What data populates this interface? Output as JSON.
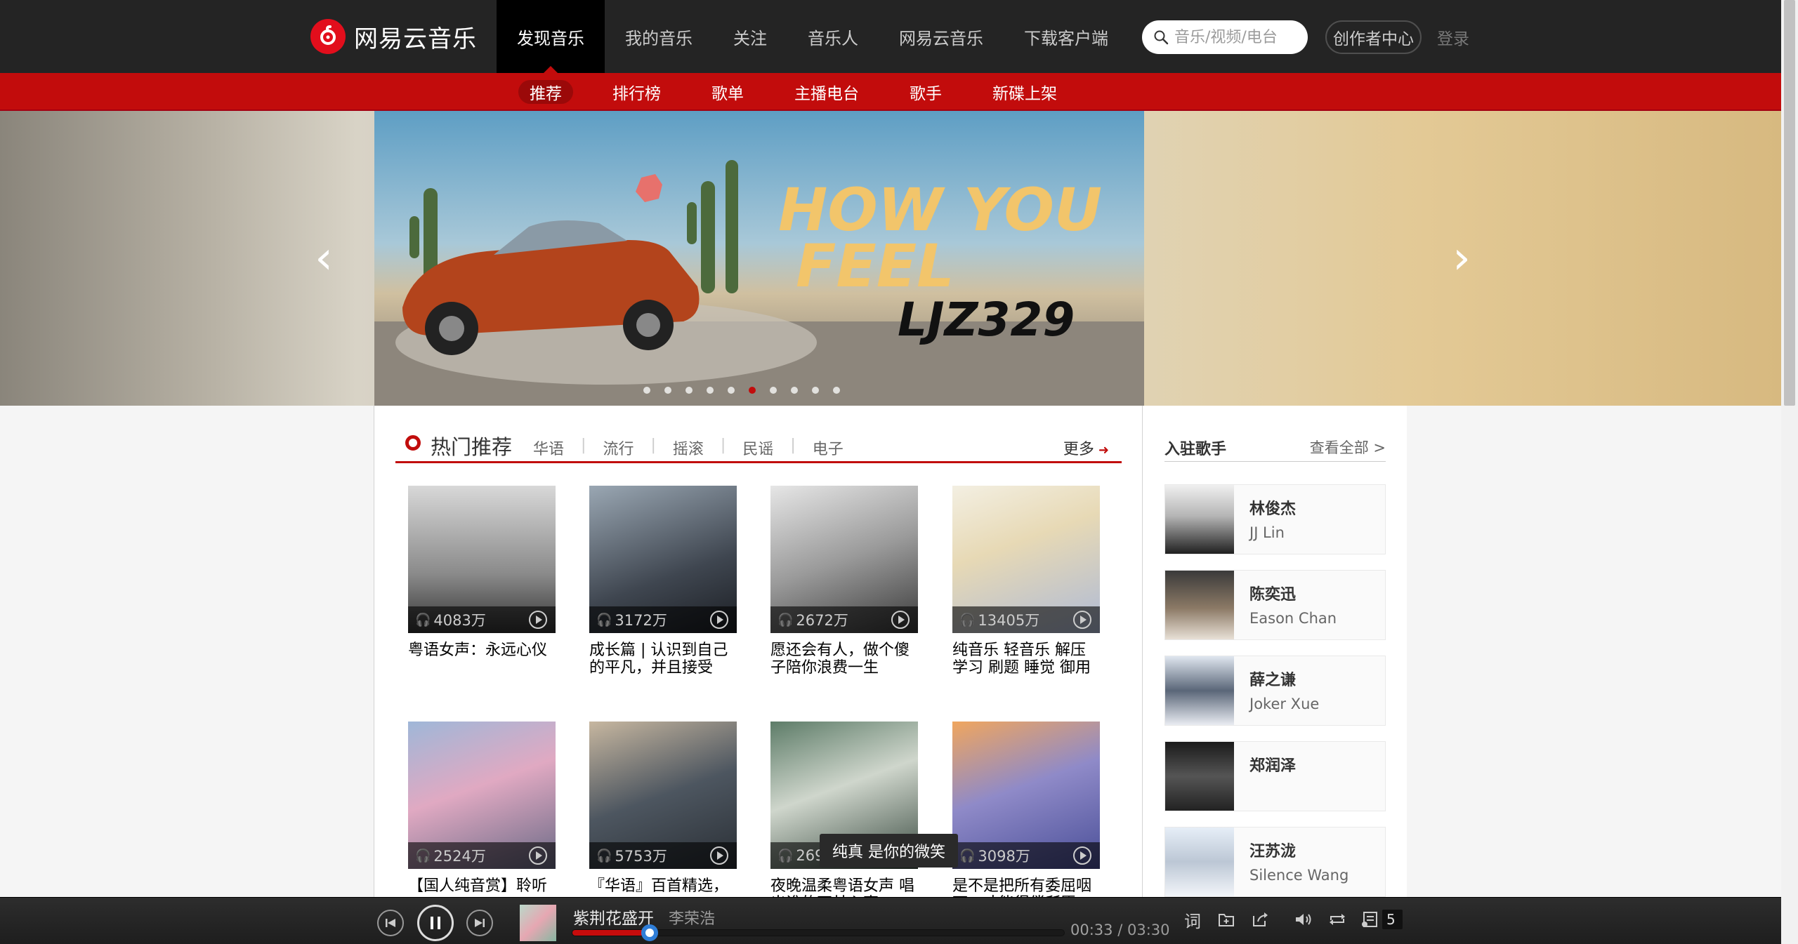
{
  "header": {
    "brand": "网易云音乐",
    "nav": [
      "发现音乐",
      "我的音乐",
      "关注",
      "音乐人",
      "网易云音乐",
      "下载客户端"
    ],
    "active_nav": 0,
    "search_placeholder": "音乐/视频/电台",
    "creator_label": "创作者中心",
    "login_label": "登录"
  },
  "subnav": {
    "items": [
      "推荐",
      "排行榜",
      "歌单",
      "主播电台",
      "歌手",
      "新碟上架"
    ],
    "active": 0
  },
  "banner": {
    "headline": "HOW YOU FEEL",
    "artist_tag": "LJZ329",
    "dot_count": 10,
    "active_dot": 5,
    "prev_symbol": "‹",
    "next_symbol": "›"
  },
  "hot": {
    "title": "热门推荐",
    "tags": [
      "华语",
      "流行",
      "摇滚",
      "民谣",
      "电子"
    ],
    "more_label": "更多",
    "cards": [
      {
        "plays": "4083万",
        "title": "粤语女声：永远心仪"
      },
      {
        "plays": "3172万",
        "title": "成长篇 | 认识到自己的平凡，并且接受"
      },
      {
        "plays": "2672万",
        "title": "愿还会有人，做个傻子陪你浪费一生"
      },
      {
        "plays": "13405万",
        "title": "纯音乐 轻音乐 解压 学习 刷题 睡觉 御用"
      },
      {
        "plays": "2524万",
        "title": "【国人纯音赏】聆听"
      },
      {
        "plays": "5753万",
        "title": "『华语』百首精选，"
      },
      {
        "plays": "269",
        "title": "夜晚温柔粤语女声 唱出谁的不甘心事"
      },
      {
        "plays": "3098万",
        "title": "是不是把所有委屈咽下，才能得偿所愿"
      }
    ],
    "tooltip": "纯真 是你的微笑"
  },
  "sidebar": {
    "title": "入驻歌手",
    "more_label": "查看全部 >",
    "singers": [
      {
        "name": "林俊杰",
        "en": "JJ Lin"
      },
      {
        "name": "陈奕迅",
        "en": "Eason Chan"
      },
      {
        "name": "薛之谦",
        "en": "Joker Xue"
      },
      {
        "name": "郑润泽",
        "en": ""
      },
      {
        "name": "汪苏泷",
        "en": "Silence Wang"
      }
    ]
  },
  "player": {
    "song": "紫荆花盛开",
    "artist": "李荣浩",
    "current_time": "00:33",
    "total_time": "03:30",
    "time_sep": " / ",
    "progress": 0.157,
    "lyric_label": "词",
    "playlist_count": "5"
  },
  "colors": {
    "topbar": "#242424",
    "brand_red": "#c20c0c",
    "accent_blue": "#2f7ed8"
  }
}
